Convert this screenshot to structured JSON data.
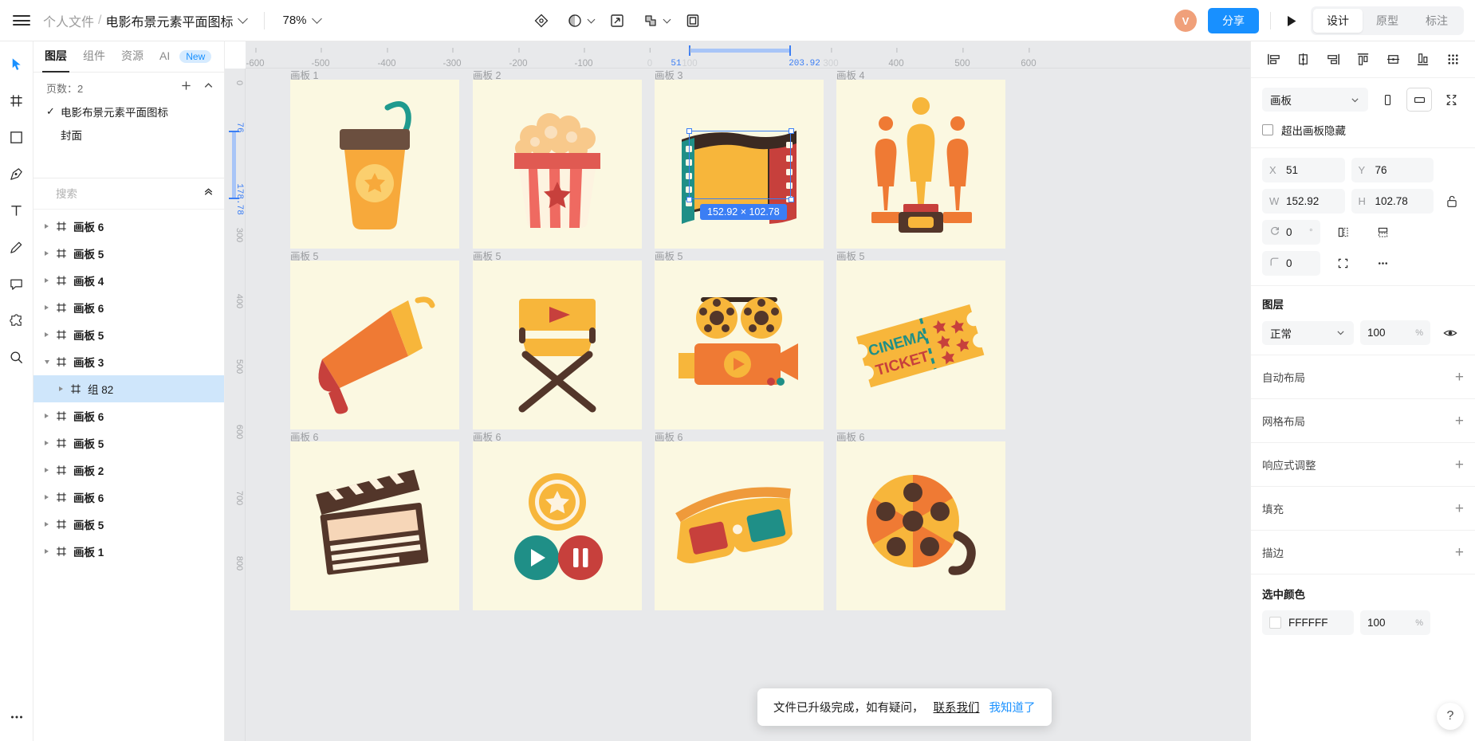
{
  "topbar": {
    "menu_icon": "hamburger-icon",
    "breadcrumb_root": "个人文件",
    "breadcrumb_sep": "/",
    "breadcrumb_file": "电影布景元素平面图标",
    "zoom_level": "78%",
    "tools": [
      {
        "name": "mask-tool",
        "icon": "diamond-dot-icon"
      },
      {
        "name": "opacity-tool",
        "icon": "half-circle-icon"
      },
      {
        "name": "export-tool",
        "icon": "arrow-out-box-icon"
      },
      {
        "name": "boolean-tool",
        "icon": "union-shapes-icon"
      },
      {
        "name": "frame-tool",
        "icon": "nested-square-icon"
      }
    ],
    "avatar_initial": "V",
    "share_label": "分享",
    "play_icon": "play-icon",
    "modes": [
      {
        "label": "设计",
        "active": true
      },
      {
        "label": "原型",
        "active": false
      },
      {
        "label": "标注",
        "active": false
      }
    ]
  },
  "rail": {
    "items": [
      {
        "name": "cursor-tool",
        "icon": "cursor-icon",
        "active": true
      },
      {
        "name": "frame-tool",
        "icon": "frame-grid-icon",
        "active": false
      },
      {
        "name": "rectangle-tool",
        "icon": "square-icon",
        "active": false
      },
      {
        "name": "pen-tool",
        "icon": "pen-nib-icon",
        "active": false
      },
      {
        "name": "text-tool",
        "icon": "letter-t-icon",
        "active": false
      },
      {
        "name": "pencil-tool",
        "icon": "pencil-icon",
        "active": false
      },
      {
        "name": "comment-tool",
        "icon": "speech-bubble-icon",
        "active": false
      },
      {
        "name": "plugin-tool",
        "icon": "puzzle-icon",
        "active": false
      },
      {
        "name": "zoom-tool",
        "icon": "magnifier-icon",
        "active": false
      }
    ],
    "more_icon": "ellipsis-icon"
  },
  "left_panel": {
    "tabs": [
      {
        "label": "图层",
        "active": true
      },
      {
        "label": "组件",
        "active": false
      },
      {
        "label": "资源",
        "active": false
      },
      {
        "label": "AI",
        "active": false,
        "badge": "New"
      }
    ],
    "pages_label": "页数：",
    "pages_count": "2",
    "pages_add_icon": "plus-icon",
    "pages_collapse_icon": "chevron-up-icon",
    "pages": [
      {
        "name": "电影布景元素平面图标",
        "checked": true
      },
      {
        "name": "封面",
        "checked": false
      }
    ],
    "search_placeholder": "搜索",
    "search_value": "",
    "search_icon": "search-icon",
    "search_filter_icon": "chevron-down-icon",
    "layers_collapse_icon": "double-chevron-up-icon",
    "layers": [
      {
        "name": "画板 6",
        "indent": 0,
        "expanded": false,
        "selected": false
      },
      {
        "name": "画板 5",
        "indent": 0,
        "expanded": false,
        "selected": false
      },
      {
        "name": "画板 4",
        "indent": 0,
        "expanded": false,
        "selected": false
      },
      {
        "name": "画板 6",
        "indent": 0,
        "expanded": false,
        "selected": false
      },
      {
        "name": "画板 5",
        "indent": 0,
        "expanded": false,
        "selected": false
      },
      {
        "name": "画板 3",
        "indent": 0,
        "expanded": true,
        "selected": false
      },
      {
        "name": "组 82",
        "indent": 1,
        "expanded": false,
        "selected": true
      },
      {
        "name": "画板 6",
        "indent": 0,
        "expanded": false,
        "selected": false
      },
      {
        "name": "画板 5",
        "indent": 0,
        "expanded": false,
        "selected": false
      },
      {
        "name": "画板 2",
        "indent": 0,
        "expanded": false,
        "selected": false
      },
      {
        "name": "画板 6",
        "indent": 0,
        "expanded": false,
        "selected": false
      },
      {
        "name": "画板 5",
        "indent": 0,
        "expanded": false,
        "selected": false
      },
      {
        "name": "画板 1",
        "indent": 0,
        "expanded": false,
        "selected": false
      }
    ]
  },
  "canvas": {
    "ruler_h_ticks": [
      "-600",
      "-500",
      "-400",
      "-300",
      "-200",
      "-100",
      "0",
      "51",
      "100",
      "203.92",
      "300",
      "400",
      "500",
      "600"
    ],
    "ruler_v_ticks": [
      "0",
      "76",
      "178.78",
      "300",
      "400",
      "500",
      "600",
      "700",
      "800"
    ],
    "selection_start_label": "51",
    "selection_end_label": "203.92",
    "selection_v_start_label": "76",
    "selection_v_end_label": "178.78",
    "board_labels_row1": [
      "画板 1",
      "画板 2",
      "画板 3",
      "画板 4"
    ],
    "board_labels_row2": [
      "画板 5",
      "画板 5",
      "画板 5",
      "画板 5"
    ],
    "board_labels_row3": [
      "画板 6",
      "画板 6",
      "画板 6",
      "画板 6"
    ],
    "selection_dimension": "152.92 × 102.78"
  },
  "toast": {
    "message": "文件已升级完成，如有疑问，",
    "link_contact": "联系我们",
    "link_ok": "我知道了"
  },
  "right_panel": {
    "align_icons": [
      "align-left-icon",
      "align-center-horizontal-icon",
      "align-right-icon",
      "align-top-icon",
      "align-middle-vertical-icon",
      "align-bottom-icon",
      "distribute-icon"
    ],
    "object_type": "画板",
    "object_type_chevron": "chevron-down-icon",
    "orientation_portrait_icon": "portrait-icon",
    "orientation_landscape_icon": "landscape-icon",
    "fit_icon": "fit-content-icon",
    "clip_label": "超出画板隐藏",
    "clip_checked": false,
    "x_label": "X",
    "x_value": "51",
    "y_label": "Y",
    "y_value": "76",
    "w_label": "W",
    "w_value": "152.92",
    "h_label": "H",
    "h_value": "102.78",
    "lock_icon": "unlock-icon",
    "rotation_icon": "rotate-icon",
    "rotation_value": "0",
    "rotation_unit": "°",
    "flip_h_icon": "flip-horizontal-icon",
    "flip_v_icon": "flip-vertical-icon",
    "corner_icon": "corner-radius-icon",
    "corner_value": "0",
    "independent_corners_icon": "corners-independent-icon",
    "more_icon": "ellipsis-icon",
    "layer_section_title": "图层",
    "blend_mode": "正常",
    "blend_chevron": "chevron-down-icon",
    "opacity_value": "100",
    "opacity_unit": "%",
    "visibility_icon": "eye-icon",
    "sections": [
      {
        "title": "自动布局",
        "action_icon": "plus-icon"
      },
      {
        "title": "网格布局",
        "action_icon": "plus-icon"
      },
      {
        "title": "响应式调整",
        "action_icon": "plus-icon"
      },
      {
        "title": "填充",
        "action_icon": "plus-icon"
      },
      {
        "title": "描边",
        "action_icon": "plus-icon"
      }
    ],
    "selected_color_title": "选中颜色",
    "selected_color_hex": "FFFFFF",
    "selected_color_opacity": "100",
    "selected_color_unit": "%",
    "help_icon": "question-mark-icon"
  },
  "colors": {
    "accent": "#1890ff",
    "selection": "#3b7ef4",
    "board_bg": "#fbf8e1",
    "canvas_bg": "#e8e9eb",
    "row_selected": "#cfe6fb"
  }
}
